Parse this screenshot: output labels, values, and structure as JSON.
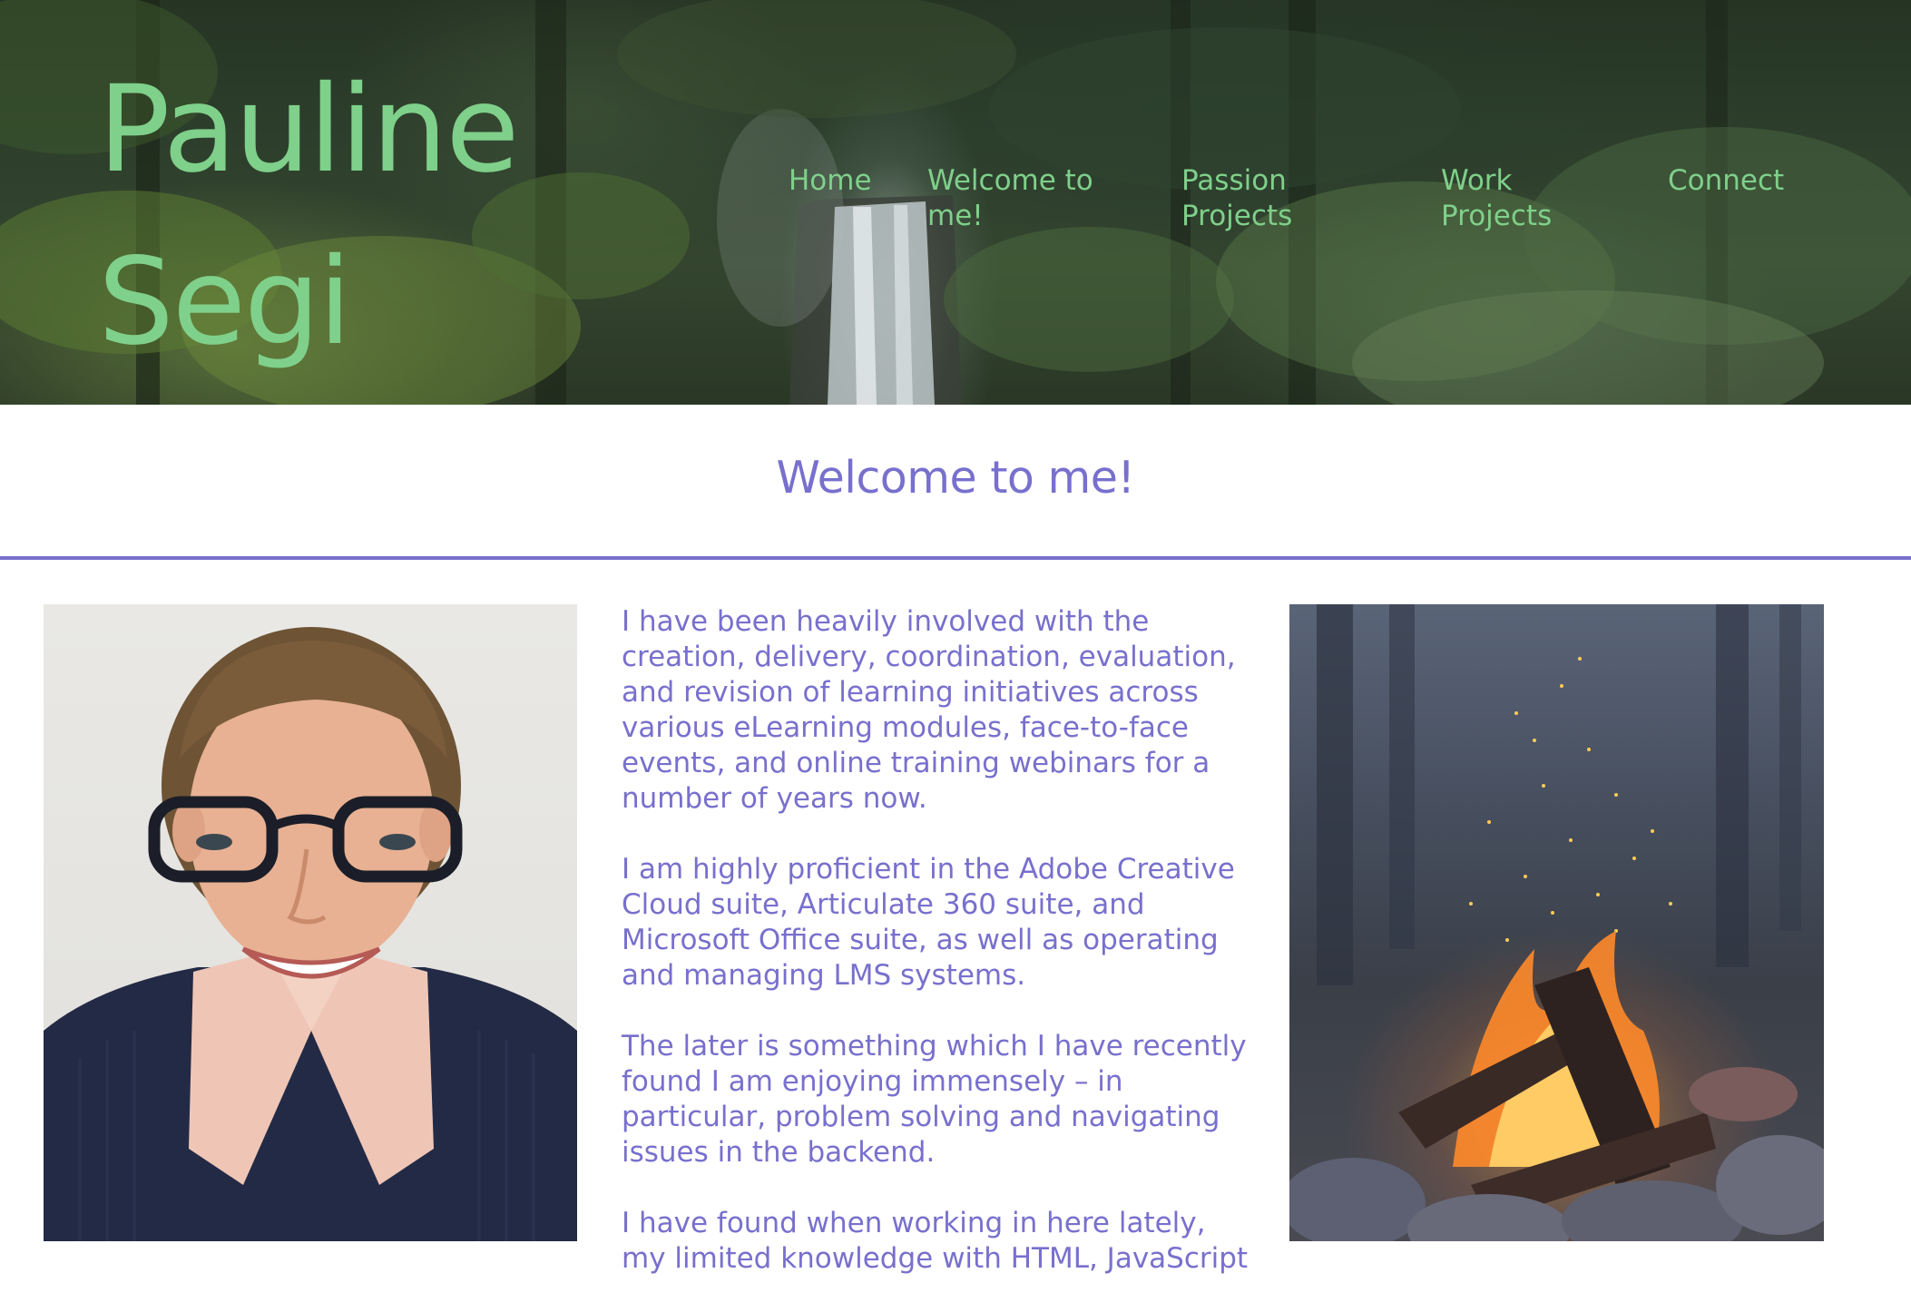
{
  "header": {
    "title_line1": "Pauline",
    "title_line2": "Segi"
  },
  "nav": {
    "items": [
      {
        "label": "Home"
      },
      {
        "label": "Welcome to me!"
      },
      {
        "label": "Passion Projects"
      },
      {
        "label": "Work Projects"
      },
      {
        "label": "Connect"
      }
    ]
  },
  "main": {
    "heading": "Welcome to me!",
    "paragraphs": [
      "I have been heavily involved with the creation, delivery, coordination, evaluation, and revision of learning initiatives across various eLearning modules, face-to-face events, and online training webinars for a number of years now.",
      "I am highly proficient in the Adobe Creative Cloud suite, Articulate 360 suite, and Microsoft Office suite, as well as operating and managing LMS systems.",
      "The later is something which I have recently found I am enjoying immensely – in particular, problem solving and navigating issues in the backend.",
      "I have found when working in here lately, my limited knowledge with HTML, JavaScript"
    ]
  },
  "colors": {
    "accent_green": "#7fd08a",
    "accent_purple": "#7870cd",
    "background": "#ffffff"
  }
}
